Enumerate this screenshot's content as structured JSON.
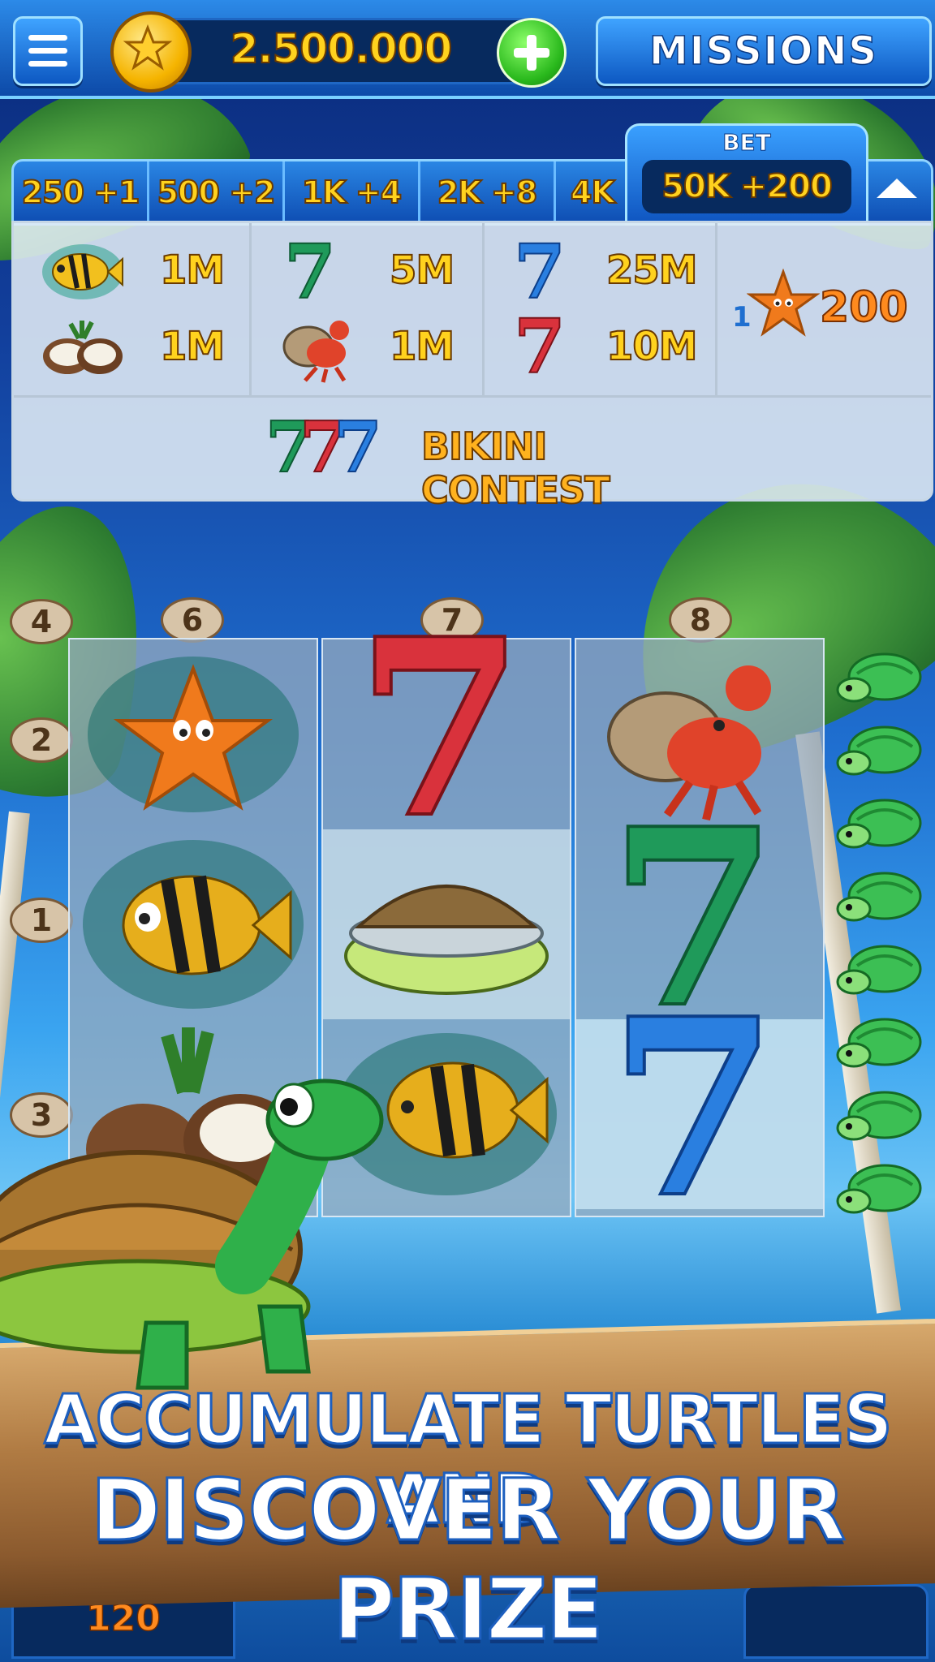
{
  "header": {
    "coin_balance": "2.500.000",
    "missions_label": "MISSIONS"
  },
  "bet": {
    "label": "BET",
    "options": [
      "250 +1",
      "500 +2",
      "1K +4",
      "2K +8",
      "4K"
    ],
    "selected": "50K +200"
  },
  "paytable": {
    "col1": [
      {
        "symbol": "yellow-fish",
        "value": "1M"
      },
      {
        "symbol": "coconut",
        "value": "1M"
      }
    ],
    "col2": [
      {
        "symbol": "green-seven",
        "value": "5M"
      },
      {
        "symbol": "hermit-crab",
        "value": "1M"
      }
    ],
    "col3": [
      {
        "symbol": "blue-seven",
        "value": "25M"
      },
      {
        "symbol": "red-seven",
        "value": "10M"
      }
    ],
    "col4": {
      "multiplier": "1",
      "symbol": "starfish",
      "value": "200"
    },
    "bonus": {
      "symbol": "777",
      "label": "BIKINI CONTEST"
    }
  },
  "paylines": {
    "left": [
      "4",
      "2",
      "1",
      "3"
    ],
    "top": [
      "6",
      "7",
      "8"
    ]
  },
  "reels": [
    [
      "starfish",
      "yellow-fish",
      "coconut"
    ],
    [
      "red-seven",
      "turtle-shell-bonus",
      "yellow-fish"
    ],
    [
      "hermit-crab",
      "green-seven",
      "blue-seven"
    ]
  ],
  "turtle_meter": {
    "count": 8
  },
  "promo": {
    "line1": "ACCUMULATE TURTLES AND",
    "line2": "DISCOVER YOUR PRIZE"
  },
  "footer": {
    "left_value": "120"
  },
  "colors": {
    "gold_text": "#ffd21e",
    "accent_blue": "#0d58c2",
    "green_seven": "#1f9a5a",
    "red_seven": "#d9323c",
    "blue_seven": "#2a7fe0"
  }
}
